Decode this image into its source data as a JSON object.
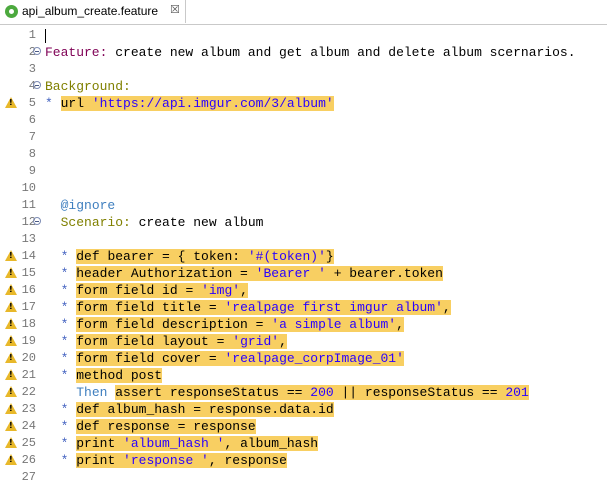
{
  "tab": {
    "title": "api_album_create.feature",
    "close": "☒",
    "icon": "feature-file-icon"
  },
  "lines": [
    {
      "n": "1",
      "text": ""
    },
    {
      "n": "2",
      "text": "Feature: create new album and get album and delete album scernarios."
    },
    {
      "n": "3",
      "text": ""
    },
    {
      "n": "4",
      "text": "Background:"
    },
    {
      "n": "5",
      "text": "* url 'https://api.imgur.com/3/album'",
      "warn": true
    },
    {
      "n": "6",
      "text": ""
    },
    {
      "n": "7",
      "text": ""
    },
    {
      "n": "8",
      "text": ""
    },
    {
      "n": "9",
      "text": ""
    },
    {
      "n": "10",
      "text": ""
    },
    {
      "n": "11",
      "text": "  @ignore"
    },
    {
      "n": "12",
      "text": "  Scenario: create new album"
    },
    {
      "n": "13",
      "text": ""
    },
    {
      "n": "14",
      "text": "  * def bearer = { token: '#(token)'}",
      "warn": true
    },
    {
      "n": "15",
      "text": "  * header Authorization = 'Bearer ' + bearer.token",
      "warn": true
    },
    {
      "n": "16",
      "text": "  * form field id = 'img',",
      "warn": true
    },
    {
      "n": "17",
      "text": "  * form field title = 'realpage first imgur album',",
      "warn": true
    },
    {
      "n": "18",
      "text": "  * form field description = 'a simple album',",
      "warn": true
    },
    {
      "n": "19",
      "text": "  * form field layout = 'grid',",
      "warn": true
    },
    {
      "n": "20",
      "text": "  * form field cover = 'realpage_corpImage_01'",
      "warn": true
    },
    {
      "n": "21",
      "text": "  * method post",
      "warn": true
    },
    {
      "n": "22",
      "text": "    Then assert responseStatus == 200 || responseStatus == 201",
      "warn": true
    },
    {
      "n": "23",
      "text": "  * def album_hash = response.data.id",
      "warn": true
    },
    {
      "n": "24",
      "text": "  * def response = response",
      "warn": true
    },
    {
      "n": "25",
      "text": "  * print 'album_hash ', album_hash",
      "warn": true
    },
    {
      "n": "26",
      "text": "  * print 'response ', response",
      "warn": true
    },
    {
      "n": "27",
      "text": ""
    }
  ]
}
